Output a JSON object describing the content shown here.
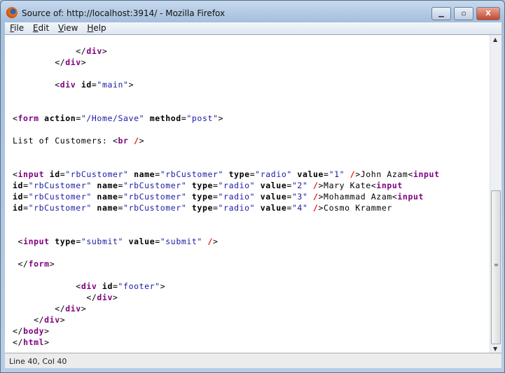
{
  "window": {
    "title": "Source of: http://localhost:3914/ - Mozilla Firefox",
    "minimize": "▁",
    "maximize": "▫",
    "close": "X"
  },
  "menu": [
    {
      "key": "F",
      "rest": "ile"
    },
    {
      "key": "E",
      "rest": "dit"
    },
    {
      "key": "V",
      "rest": "iew"
    },
    {
      "key": "H",
      "rest": "elp"
    }
  ],
  "source": {
    "lines": [
      [
        [
          "p",
          "            </"
        ],
        [
          "t",
          "div"
        ],
        [
          "p",
          ">"
        ]
      ],
      [
        [
          "p",
          "        </"
        ],
        [
          "t",
          "div"
        ],
        [
          "p",
          ">"
        ]
      ],
      [],
      [
        [
          "p",
          "        <"
        ],
        [
          "t",
          "div"
        ],
        [
          "p",
          " "
        ],
        [
          "a",
          "id"
        ],
        [
          "p",
          "="
        ],
        [
          "v",
          "\"main\""
        ],
        [
          "p",
          ">"
        ]
      ],
      [],
      [],
      [
        [
          "p",
          "<"
        ],
        [
          "t",
          "form"
        ],
        [
          "p",
          " "
        ],
        [
          "a",
          "action"
        ],
        [
          "p",
          "="
        ],
        [
          "v",
          "\"/Home/Save\""
        ],
        [
          "p",
          " "
        ],
        [
          "a",
          "method"
        ],
        [
          "p",
          "="
        ],
        [
          "v",
          "\"post\""
        ],
        [
          "p",
          ">"
        ]
      ],
      [],
      [
        [
          "p",
          "List of Customers: <"
        ],
        [
          "t",
          "br"
        ],
        [
          "p",
          " "
        ],
        [
          "r",
          "/"
        ],
        [
          "p",
          ">"
        ]
      ],
      [],
      [],
      [
        [
          "p",
          "<"
        ],
        [
          "t",
          "input"
        ],
        [
          "p",
          " "
        ],
        [
          "a",
          "id"
        ],
        [
          "p",
          "="
        ],
        [
          "v",
          "\"rbCustomer\""
        ],
        [
          "p",
          " "
        ],
        [
          "a",
          "name"
        ],
        [
          "p",
          "="
        ],
        [
          "v",
          "\"rbCustomer\""
        ],
        [
          "p",
          " "
        ],
        [
          "a",
          "type"
        ],
        [
          "p",
          "="
        ],
        [
          "v",
          "\"radio\""
        ],
        [
          "p",
          " "
        ],
        [
          "a",
          "value"
        ],
        [
          "p",
          "="
        ],
        [
          "v",
          "\"1\""
        ],
        [
          "p",
          " "
        ],
        [
          "r",
          "/"
        ],
        [
          "p",
          ">John Azam<"
        ],
        [
          "t",
          "input"
        ]
      ],
      [
        [
          "a",
          "id"
        ],
        [
          "p",
          "="
        ],
        [
          "v",
          "\"rbCustomer\""
        ],
        [
          "p",
          " "
        ],
        [
          "a",
          "name"
        ],
        [
          "p",
          "="
        ],
        [
          "v",
          "\"rbCustomer\""
        ],
        [
          "p",
          " "
        ],
        [
          "a",
          "type"
        ],
        [
          "p",
          "="
        ],
        [
          "v",
          "\"radio\""
        ],
        [
          "p",
          " "
        ],
        [
          "a",
          "value"
        ],
        [
          "p",
          "="
        ],
        [
          "v",
          "\"2\""
        ],
        [
          "p",
          " "
        ],
        [
          "r",
          "/"
        ],
        [
          "p",
          ">Mary Kate<"
        ],
        [
          "t",
          "input"
        ]
      ],
      [
        [
          "a",
          "id"
        ],
        [
          "p",
          "="
        ],
        [
          "v",
          "\"rbCustomer\""
        ],
        [
          "p",
          " "
        ],
        [
          "a",
          "name"
        ],
        [
          "p",
          "="
        ],
        [
          "v",
          "\"rbCustomer\""
        ],
        [
          "p",
          " "
        ],
        [
          "a",
          "type"
        ],
        [
          "p",
          "="
        ],
        [
          "v",
          "\"radio\""
        ],
        [
          "p",
          " "
        ],
        [
          "a",
          "value"
        ],
        [
          "p",
          "="
        ],
        [
          "v",
          "\"3\""
        ],
        [
          "p",
          " "
        ],
        [
          "r",
          "/"
        ],
        [
          "p",
          ">Mohammad Azam<"
        ],
        [
          "t",
          "input"
        ]
      ],
      [
        [
          "a",
          "id"
        ],
        [
          "p",
          "="
        ],
        [
          "v",
          "\"rbCustomer\""
        ],
        [
          "p",
          " "
        ],
        [
          "a",
          "name"
        ],
        [
          "p",
          "="
        ],
        [
          "v",
          "\"rbCustomer\""
        ],
        [
          "p",
          " "
        ],
        [
          "a",
          "type"
        ],
        [
          "p",
          "="
        ],
        [
          "v",
          "\"radio\""
        ],
        [
          "p",
          " "
        ],
        [
          "a",
          "value"
        ],
        [
          "p",
          "="
        ],
        [
          "v",
          "\"4\""
        ],
        [
          "p",
          " "
        ],
        [
          "r",
          "/"
        ],
        [
          "p",
          ">Cosmo Krammer"
        ]
      ],
      [],
      [],
      [
        [
          "p",
          " <"
        ],
        [
          "t",
          "input"
        ],
        [
          "p",
          " "
        ],
        [
          "a",
          "type"
        ],
        [
          "p",
          "="
        ],
        [
          "v",
          "\"submit\""
        ],
        [
          "p",
          " "
        ],
        [
          "a",
          "value"
        ],
        [
          "p",
          "="
        ],
        [
          "v",
          "\"submit\""
        ],
        [
          "p",
          " "
        ],
        [
          "r",
          "/"
        ],
        [
          "p",
          ">"
        ]
      ],
      [],
      [
        [
          "p",
          " </"
        ],
        [
          "t",
          "form"
        ],
        [
          "p",
          ">"
        ]
      ],
      [],
      [
        [
          "p",
          "            <"
        ],
        [
          "t",
          "div"
        ],
        [
          "p",
          " "
        ],
        [
          "a",
          "id"
        ],
        [
          "p",
          "="
        ],
        [
          "v",
          "\"footer\""
        ],
        [
          "p",
          ">"
        ]
      ],
      [
        [
          "p",
          "              </"
        ],
        [
          "t",
          "div"
        ],
        [
          "p",
          ">"
        ]
      ],
      [
        [
          "p",
          "        </"
        ],
        [
          "t",
          "div"
        ],
        [
          "p",
          ">"
        ]
      ],
      [
        [
          "p",
          "    </"
        ],
        [
          "t",
          "div"
        ],
        [
          "p",
          ">"
        ]
      ],
      [
        [
          "p",
          "</"
        ],
        [
          "t",
          "body"
        ],
        [
          "p",
          ">"
        ]
      ],
      [
        [
          "p",
          "</"
        ],
        [
          "t",
          "html"
        ],
        [
          "p",
          ">"
        ]
      ]
    ]
  },
  "status": "Line 40, Col 40",
  "colors": {
    "tag": "#800080",
    "attribute": "#000000",
    "value": "#1a1aa6",
    "self_close": "#ee0000"
  }
}
